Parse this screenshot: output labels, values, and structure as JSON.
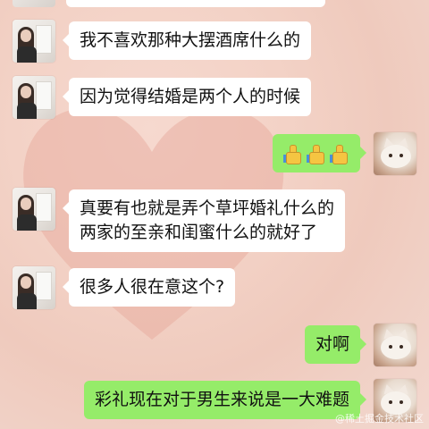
{
  "messages": [
    {
      "side": "left",
      "text": "我不喜欢那种大摆酒席什么的"
    },
    {
      "side": "left",
      "text": "因为觉得结婚是两个人的时候"
    },
    {
      "side": "right",
      "emoji": [
        "thumbs-up-icon",
        "thumbs-up-icon",
        "thumbs-up-icon"
      ]
    },
    {
      "side": "left",
      "lines": [
        "真要有也就是弄个草坪婚礼什么的",
        "两家的至亲和闺蜜什么的就好了"
      ]
    },
    {
      "side": "left",
      "text": "很多人很在意这个?"
    },
    {
      "side": "right",
      "text": "对啊"
    },
    {
      "side": "right",
      "text": "彩礼现在对于男生来说是一大难题"
    }
  ],
  "watermark": "@稀土掘金技术社区",
  "colors": {
    "sent_bubble": "#95ec69",
    "received_bubble": "#ffffff",
    "background": "#f3d2c6"
  }
}
